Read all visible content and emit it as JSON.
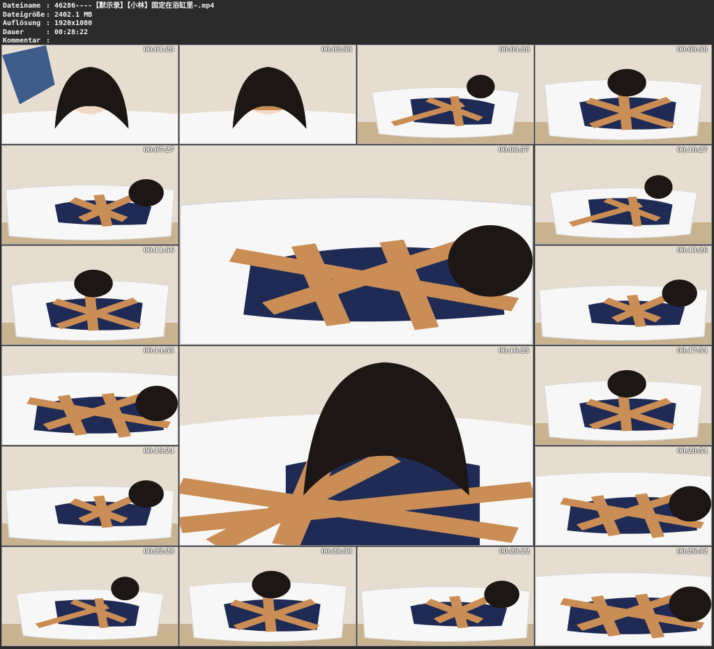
{
  "header": {
    "fields": [
      {
        "label": "Dateiname",
        "value": "46286----【默示录】【小林】固定在浴缸里~.mp4"
      },
      {
        "label": "Dateigröße",
        "value": "2402.1 MB"
      },
      {
        "label": "Auflösung",
        "value": "1920x1080"
      },
      {
        "label": "Dauer",
        "value": "00:28:22"
      },
      {
        "label": "Kommentar",
        "value": ""
      }
    ]
  },
  "thumbnails": [
    {
      "timestamp": "00:01:29"
    },
    {
      "timestamp": "00:02:59"
    },
    {
      "timestamp": "00:04:28"
    },
    {
      "timestamp": "00:05:58"
    },
    {
      "timestamp": "00:07:27"
    },
    {
      "timestamp": "00:08:57"
    },
    {
      "timestamp": "00:10:27"
    },
    {
      "timestamp": "00:11:56"
    },
    {
      "timestamp": "00:13:26"
    },
    {
      "timestamp": "00:14:55"
    },
    {
      "timestamp": "00:16:25"
    },
    {
      "timestamp": "00:17:54"
    },
    {
      "timestamp": "00:19:24"
    },
    {
      "timestamp": "00:20:54"
    },
    {
      "timestamp": "00:22:23"
    },
    {
      "timestamp": "00:23:53"
    },
    {
      "timestamp": "00:25:22"
    },
    {
      "timestamp": "00:26:52"
    }
  ],
  "colors": {
    "background": "#2b2b2b",
    "header_text": "#f2f2f2",
    "wall": "#e6ddd0",
    "tub": "#f7f7f7",
    "tape": "#c98d55",
    "hair": "#1c1614",
    "dress": "#1f2a55"
  }
}
